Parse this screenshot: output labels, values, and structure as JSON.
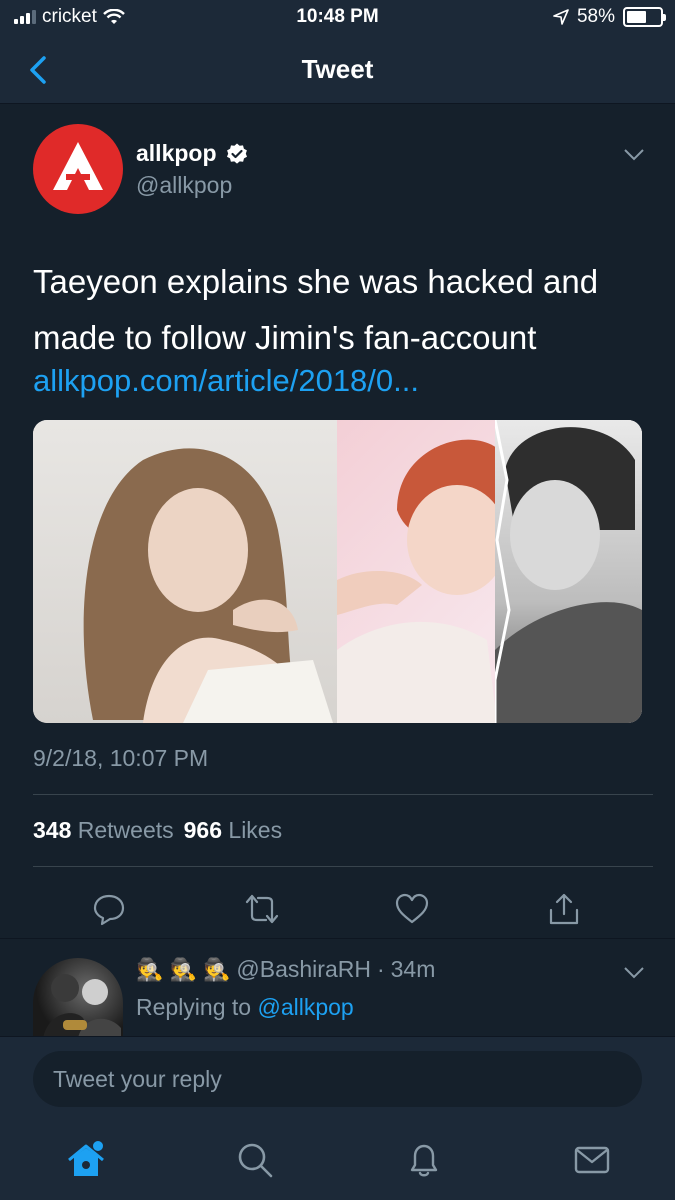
{
  "status_bar": {
    "carrier": "cricket",
    "time": "10:48 PM",
    "battery": "58%",
    "battery_level": 0.58
  },
  "nav": {
    "title": "Tweet"
  },
  "tweet": {
    "author_name": "allkpop",
    "author_handle": "@allkpop",
    "text": "Taeyeon explains she was hacked and made to follow Jimin's fan-account",
    "link": "allkpop.com/article/2018/0...",
    "timestamp": "9/2/18, 10:07 PM",
    "retweets_count": "348",
    "retweets_label": "Retweets",
    "likes_count": "966",
    "likes_label": "Likes"
  },
  "reply": {
    "emojis": "🕵️ 🕵️ 🕵️",
    "handle": "@BashiraRH",
    "separator": "·",
    "time": "34m",
    "replying_prefix": "Replying to",
    "replying_to": "@allkpop"
  },
  "composer": {
    "placeholder": "Tweet your reply"
  },
  "colors": {
    "background": "#15202b",
    "bar": "#1c2938",
    "accent": "#1da1f2",
    "muted": "#8899a6"
  }
}
